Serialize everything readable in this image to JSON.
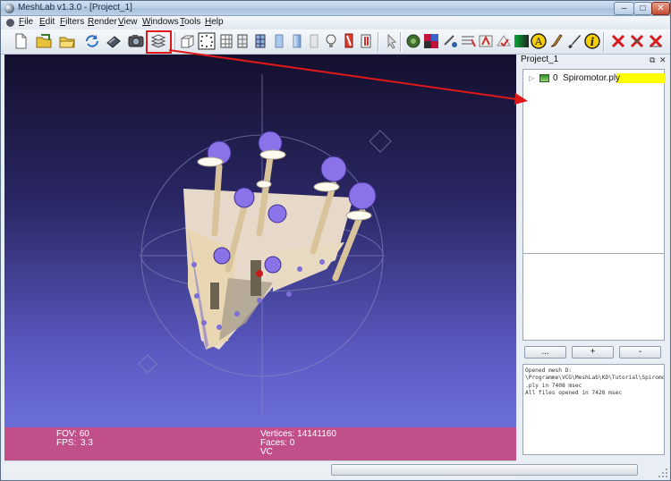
{
  "window": {
    "title": "MeshLab v1.3.0 - [Project_1]",
    "min_symbol": "–",
    "max_symbol": "□",
    "close_symbol": "✕"
  },
  "menu": {
    "items": [
      {
        "first": "F",
        "rest": "ile"
      },
      {
        "first": "E",
        "rest": "dit"
      },
      {
        "first": "F",
        "rest": "ilters"
      },
      {
        "first": "R",
        "rest": "ender"
      },
      {
        "first": "V",
        "rest": "iew"
      },
      {
        "first": "W",
        "rest": "indows"
      },
      {
        "first": "T",
        "rest": "ools"
      },
      {
        "first": "H",
        "rest": "elp"
      }
    ]
  },
  "toolbar": {
    "icons": [
      "new-document-icon",
      "open-project-icon",
      "open-mesh-icon",
      "reload-icon",
      "save-icon",
      "snapshot-icon",
      "layer-dialog-icon",
      "bounding-box-icon",
      "points-icon",
      "wireframe-icon",
      "hidden-lines-icon",
      "flat-lines-icon",
      "flat-icon",
      "smooth-icon",
      "texture-icon",
      "light-icon",
      "double-light-icon",
      "select-icon",
      "paint-icon",
      "color-icon",
      "pick-points-icon",
      "measure-icon",
      "align-icon",
      "quality-icon",
      "annotation-icon",
      "brush-icon",
      "info-icon",
      "delete-faces-icon",
      "delete-vertices-icon",
      "delete-all-icon"
    ],
    "highlight_color": "#e01818"
  },
  "viewport": {
    "fov_label": "FOV: 60",
    "fps_label": "FPS:",
    "fps_value": "3.3",
    "vertices_label": "Vertices: 14141160",
    "faces_label": "Faces: 0",
    "vc_label": "VC",
    "info_bar_color": "#c1508a"
  },
  "dock": {
    "title": "Project_1",
    "float_symbol": "⧉",
    "close_symbol": "✕",
    "layer": {
      "index": "0",
      "name": "Spiromotor.ply",
      "selected_color": "#ffff00"
    },
    "buttons": {
      "more": "...",
      "plus": "+",
      "minus": "-"
    },
    "log": [
      "Opened mesh D:",
      "\\Programme\\VCG\\MeshLab\\KD\\Tutorial\\Spiromotor",
      ".ply in 7408 msec",
      "All files opened in 7428 msec"
    ]
  },
  "annotation": {
    "arrow_color": "#e01818"
  }
}
